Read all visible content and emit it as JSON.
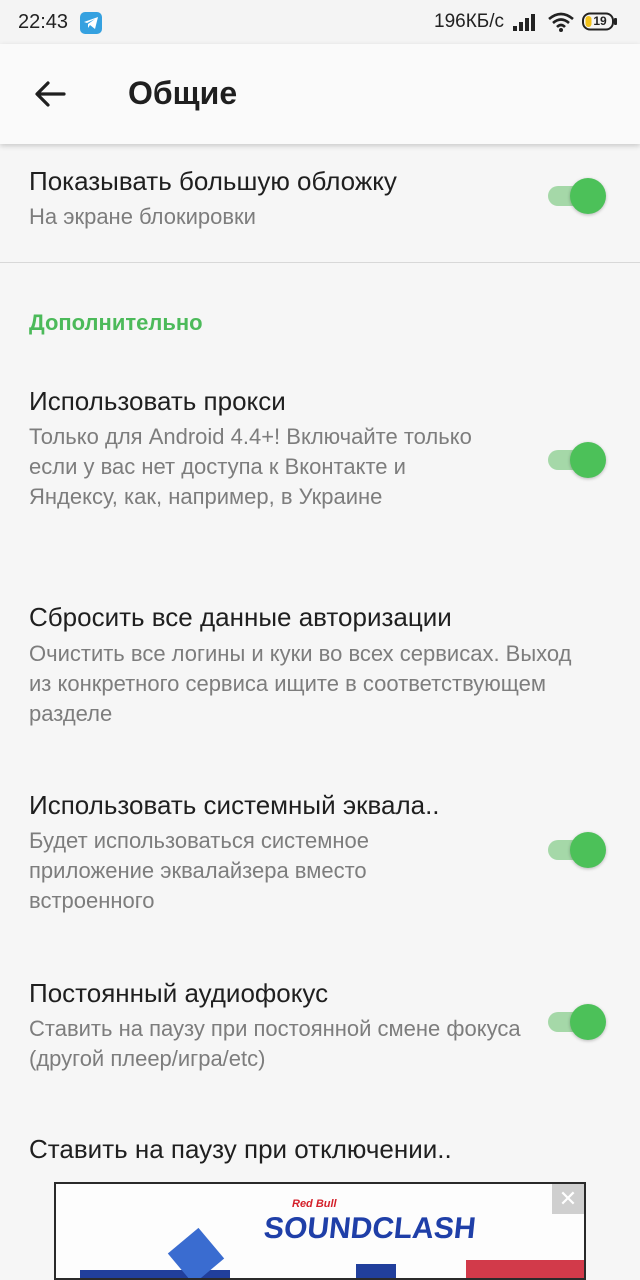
{
  "status_bar": {
    "time": "22:43",
    "net_speed": "196КБ/с",
    "battery": "19",
    "icons": [
      "telegram-icon",
      "signal-icon",
      "wifi-icon",
      "battery-icon"
    ]
  },
  "app_bar": {
    "title": "Общие",
    "back_icon": "arrow-left-icon"
  },
  "settings": {
    "cover": {
      "title": "Показывать большую обложку",
      "summary": "На экране блокировки",
      "enabled": true
    },
    "section_header": "Дополнительно",
    "proxy": {
      "title": "Использовать прокси",
      "summary": "Только для Android 4.4+! Включайте только если у вас нет доступа к Вконтакте и Яндексу, как, например, в Украине",
      "enabled": true
    },
    "reset_auth": {
      "title": "Сбросить все данные авторизации",
      "summary": "Очистить все логины и куки во всех сервисах. Выход из конкретного сервиса ищите в соответствующем разделе"
    },
    "system_eq": {
      "title": "Использовать системный эквала..",
      "summary": "Будет использоваться системное приложение эквалайзера вместо встроенного",
      "enabled": true
    },
    "audio_focus": {
      "title": "Постоянный аудиофокус",
      "summary": "Ставить на паузу при постоянной смене фокуса (другой плеер/игра/etc)",
      "enabled": true
    },
    "pause_disconnect": {
      "title": "Ставить на паузу при отключении.."
    }
  },
  "ad": {
    "brand": "Red Bull",
    "headline": "SOUNDCLASH",
    "close_label": "✕"
  },
  "colors": {
    "accent": "#4cba5a",
    "toggle_thumb": "#4cc159",
    "toggle_track": "#a5d8a8",
    "background": "#f6f6f6"
  }
}
